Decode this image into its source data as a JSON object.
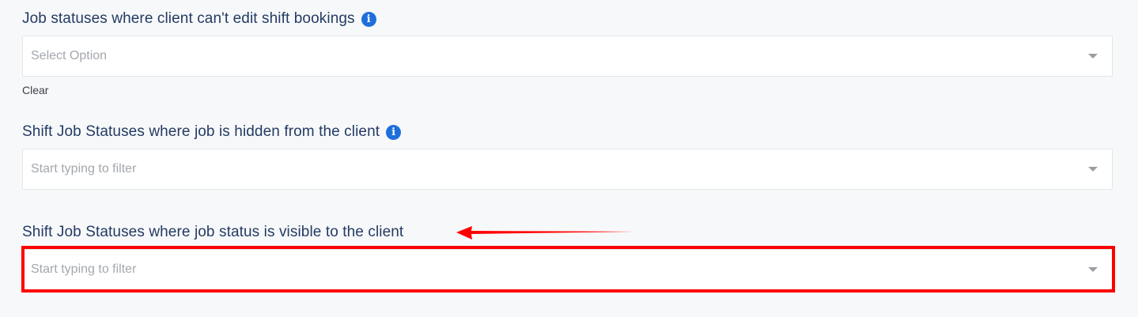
{
  "fields": [
    {
      "label": "Job statuses where client can't edit shift bookings",
      "has_info_icon": true,
      "placeholder": "Select Option",
      "clear_label": "Clear"
    },
    {
      "label": "Shift Job Statuses where job is hidden from the client",
      "has_info_icon": true,
      "placeholder": "Start typing to filter"
    },
    {
      "label": "Shift Job Statuses where job status is visible to the client",
      "has_info_icon": false,
      "placeholder": "Start typing to filter"
    }
  ],
  "icons": {
    "info": "i"
  },
  "annotation": {
    "highlight_color": "#ff0000",
    "arrow_color": "#ff0000"
  }
}
